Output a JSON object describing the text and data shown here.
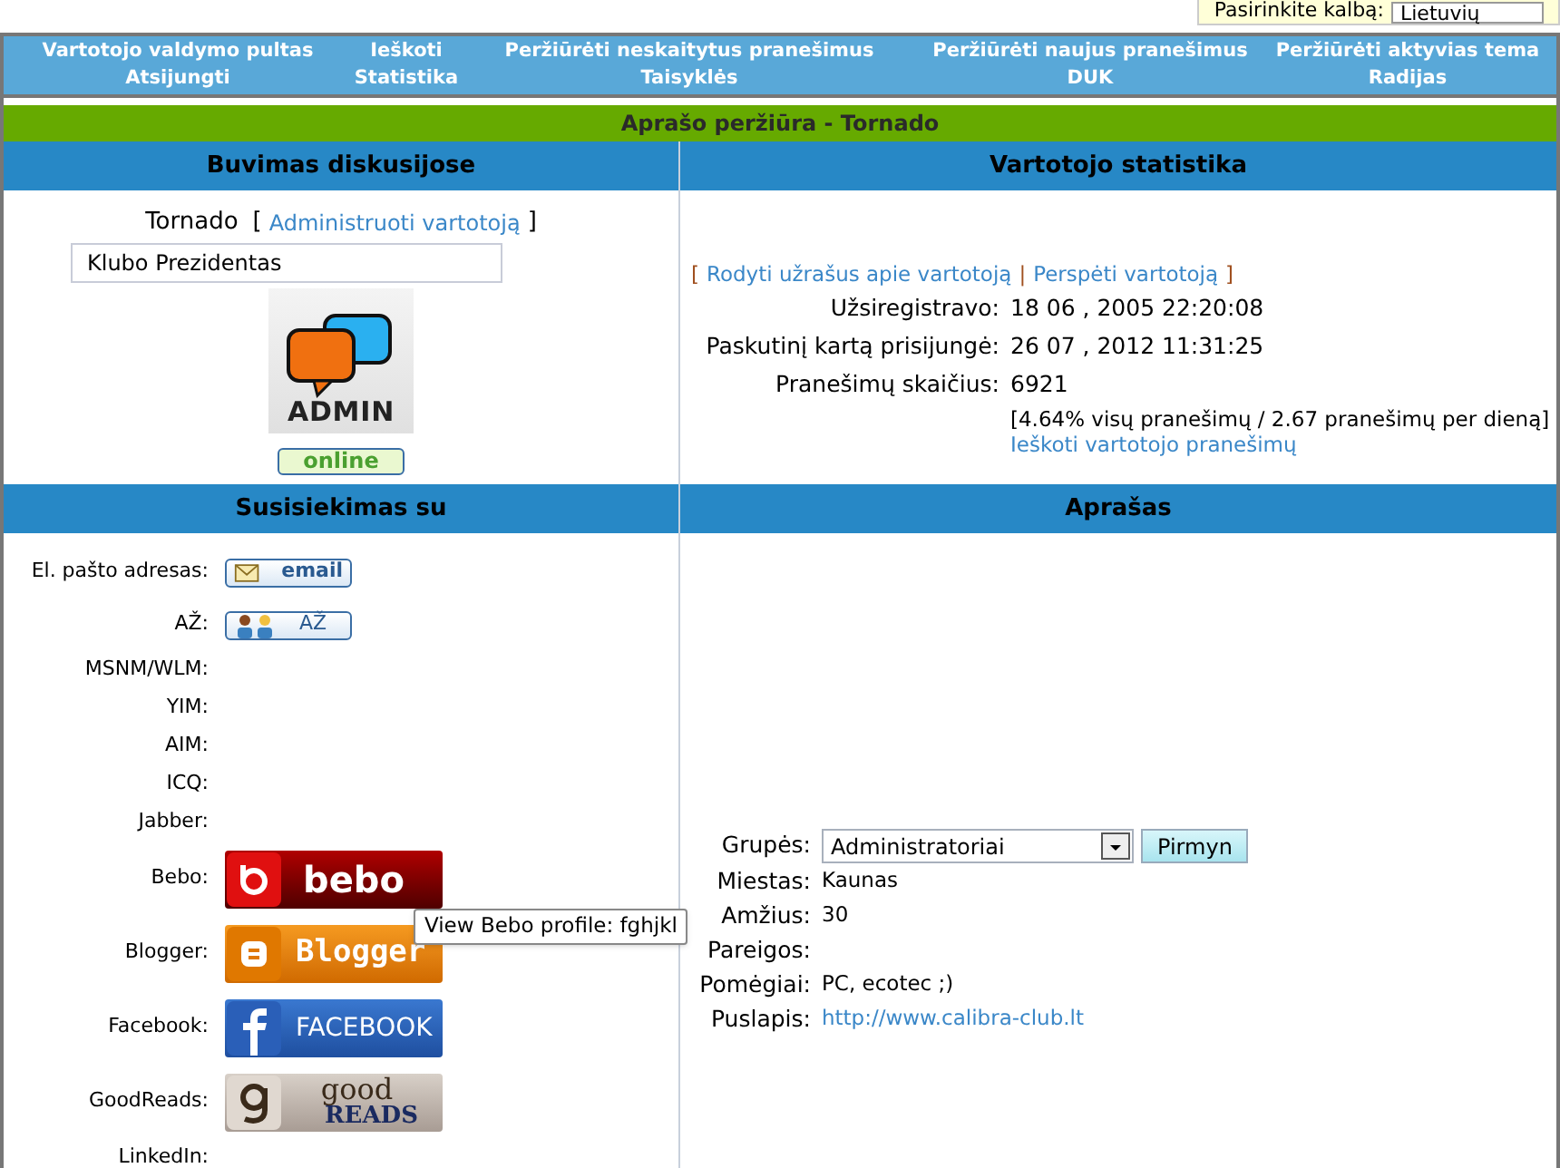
{
  "language": {
    "label": "Pasirinkite kalbą:",
    "value": "Lietuvių"
  },
  "nav_rows": [
    {
      "items": [
        "Vartotojo valdymo pultas",
        "Ieškoti",
        "Peržiūrėti neskaitytus pranešimus",
        "Peržiūrėti naujus pranešimus",
        "Peržiūrėti aktyvias tema"
      ]
    },
    {
      "items": [
        "Atsijungti",
        "Statistika",
        "Taisyklės",
        "DUK",
        "Radijas"
      ]
    }
  ],
  "page_title": "Aprašo peržiūra - Tornado",
  "presence": {
    "heading": "Buvimas diskusijose",
    "username": "Tornado",
    "admin_link": "Administruoti vartotoją",
    "rank": "Klubo Prezidentas",
    "avatar_text": "ADMIN",
    "status": "online",
    "online": true,
    "bracket_open": "[",
    "bracket_close": "]"
  },
  "statistics": {
    "heading": "Vartotojo statistika",
    "links": [
      "Rodyti užrašus apie vartotoją",
      "Perspėti vartotoją"
    ],
    "bracket_open": "[",
    "separator": "|",
    "bracket_close": "]",
    "rows": [
      {
        "label": "Užsiregistravo:",
        "value": "18 06 , 2005 22:20:08"
      },
      {
        "label": "Paskutinį kartą prisijungė:",
        "value": "26 07 , 2012 11:31:25"
      },
      {
        "label": "Pranešimų skaičius:",
        "value": "6921"
      }
    ],
    "posts_detail": "[4.64% visų pranešimų / 2.67 pranešimų per dieną]",
    "search_link": "Ieškoti vartotojo pranešimų"
  },
  "contact": {
    "heading": "Susisiekimas su",
    "items": [
      {
        "label": "El. pašto adresas:",
        "kind": "email",
        "text": "email"
      },
      {
        "label": "AŽ:",
        "kind": "pm",
        "text": "AŽ"
      },
      {
        "label": "MSNM/WLM:",
        "kind": "none"
      },
      {
        "label": "YIM:",
        "kind": "none"
      },
      {
        "label": "AIM:",
        "kind": "none"
      },
      {
        "label": "ICQ:",
        "kind": "none"
      },
      {
        "label": "Jabber:",
        "kind": "none"
      },
      {
        "label": "Bebo:",
        "kind": "bebo",
        "text": "bebo"
      },
      {
        "label": "Blogger:",
        "kind": "blogger",
        "text": "Blogger"
      },
      {
        "label": "Facebook:",
        "kind": "facebook",
        "text": "FACEBOOK"
      },
      {
        "label": "GoodReads:",
        "kind": "goodreads",
        "text": "good",
        "text2": "READS"
      },
      {
        "label": "LinkedIn:",
        "kind": "none"
      }
    ]
  },
  "tooltip": "View Bebo profile: fghjkl",
  "profile": {
    "heading": "Aprašas",
    "groups": {
      "label": "Grupės:",
      "value": "Administratoriai"
    },
    "go_button": "Pirmyn",
    "fields": [
      {
        "label": "Miestas:",
        "value": "Kaunas",
        "kind": "text"
      },
      {
        "label": "Amžius:",
        "value": "30",
        "kind": "text"
      },
      {
        "label": "Pareigos:",
        "kind": "text"
      },
      {
        "label": "Pomėgiai:",
        "value": "PC, ecotec ;)",
        "kind": "text"
      },
      {
        "label": "Puslapis:",
        "value": "http://www.calibra-club.lt",
        "kind": "link"
      }
    ]
  }
}
